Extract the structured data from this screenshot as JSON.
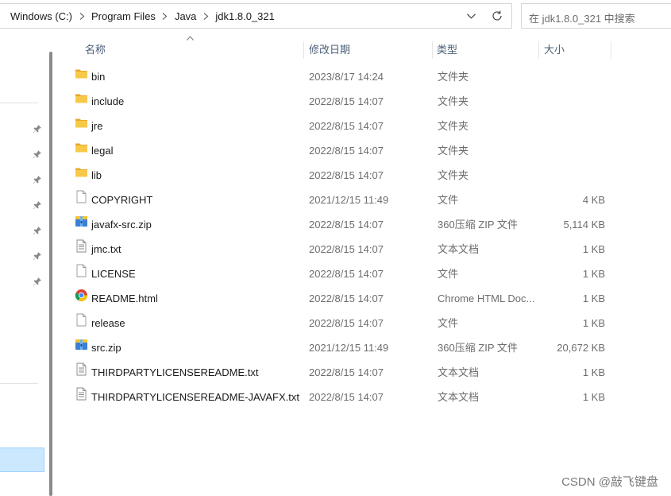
{
  "address_bar": {
    "crumbs": [
      "Windows (C:)",
      "Program Files",
      "Java",
      "jdk1.8.0_321"
    ],
    "dropdown_icon": "chevron-down-icon",
    "refresh_icon": "refresh-icon"
  },
  "search": {
    "placeholder": "在 jdk1.8.0_321 中搜索"
  },
  "columns": {
    "name": "名称",
    "date": "修改日期",
    "type": "类型",
    "size": "大小"
  },
  "files": [
    {
      "name": "bin",
      "date": "2023/8/17 14:24",
      "type": "文件夹",
      "size": "",
      "icon": "folder-icon"
    },
    {
      "name": "include",
      "date": "2022/8/15 14:07",
      "type": "文件夹",
      "size": "",
      "icon": "folder-icon"
    },
    {
      "name": "jre",
      "date": "2022/8/15 14:07",
      "type": "文件夹",
      "size": "",
      "icon": "folder-icon"
    },
    {
      "name": "legal",
      "date": "2022/8/15 14:07",
      "type": "文件夹",
      "size": "",
      "icon": "folder-icon"
    },
    {
      "name": "lib",
      "date": "2022/8/15 14:07",
      "type": "文件夹",
      "size": "",
      "icon": "folder-icon"
    },
    {
      "name": "COPYRIGHT",
      "date": "2021/12/15 11:49",
      "type": "文件",
      "size": "4 KB",
      "icon": "file-icon"
    },
    {
      "name": "javafx-src.zip",
      "date": "2022/8/15 14:07",
      "type": "360压缩 ZIP 文件",
      "size": "5,114 KB",
      "icon": "zip-archive-icon"
    },
    {
      "name": "jmc.txt",
      "date": "2022/8/15 14:07",
      "type": "文本文档",
      "size": "1 KB",
      "icon": "text-file-icon"
    },
    {
      "name": "LICENSE",
      "date": "2022/8/15 14:07",
      "type": "文件",
      "size": "1 KB",
      "icon": "file-icon"
    },
    {
      "name": "README.html",
      "date": "2022/8/15 14:07",
      "type": "Chrome HTML Doc...",
      "size": "1 KB",
      "icon": "chrome-icon"
    },
    {
      "name": "release",
      "date": "2022/8/15 14:07",
      "type": "文件",
      "size": "1 KB",
      "icon": "file-icon"
    },
    {
      "name": "src.zip",
      "date": "2021/12/15 11:49",
      "type": "360压缩 ZIP 文件",
      "size": "20,672 KB",
      "icon": "zip-archive-icon"
    },
    {
      "name": "THIRDPARTYLICENSEREADME.txt",
      "date": "2022/8/15 14:07",
      "type": "文本文档",
      "size": "1 KB",
      "icon": "text-file-icon"
    },
    {
      "name": "THIRDPARTYLICENSEREADME-JAVAFX.txt",
      "date": "2022/8/15 14:07",
      "type": "文本文档",
      "size": "1 KB",
      "icon": "text-file-icon"
    }
  ],
  "nav": {
    "pin_icon": "pin-icon",
    "pin_count": 7
  },
  "watermark": "CSDN @敲飞键盘",
  "colors": {
    "folder": "#f8c949",
    "selection": "#cce8ff",
    "header_text": "#4c607a"
  }
}
